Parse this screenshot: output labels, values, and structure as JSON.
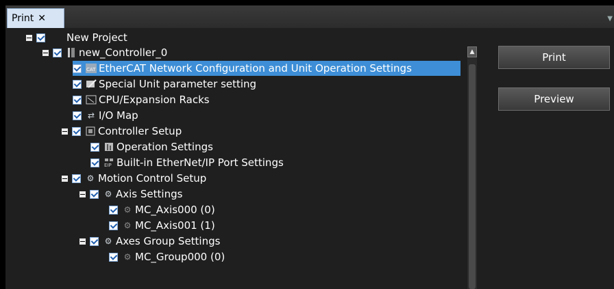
{
  "tab": {
    "title": "Print",
    "close_glyph": "✕"
  },
  "buttons": {
    "print": "Print",
    "preview": "Preview"
  },
  "tree": [
    {
      "label": "New Project",
      "icon": "none"
    },
    {
      "label": "new_Controller_0",
      "icon": "controller-icon"
    },
    {
      "label": "EtherCAT Network Configuration and Unit Operation Settings",
      "icon": "ethercat-icon",
      "selected": true
    },
    {
      "label": "Special Unit parameter setting",
      "icon": "parameter-icon"
    },
    {
      "label": "CPU/Expansion Racks",
      "icon": "rack-icon"
    },
    {
      "label": "I/O Map",
      "icon": "io-map-icon"
    },
    {
      "label": "Controller Setup",
      "icon": "controller-setup-icon"
    },
    {
      "label": "Operation Settings",
      "icon": "operation-settings-icon"
    },
    {
      "label": "Built-in EtherNet/IP Port Settings",
      "icon": "ethernet-ip-icon"
    },
    {
      "label": "Motion Control Setup",
      "icon": "motion-gear-icon"
    },
    {
      "label": "Axis Settings",
      "icon": "axis-gear-icon"
    },
    {
      "label": "MC_Axis000 (0)",
      "icon": "axis-item-icon"
    },
    {
      "label": "MC_Axis001 (1)",
      "icon": "axis-item-icon"
    },
    {
      "label": "Axes Group Settings",
      "icon": "axes-group-icon"
    },
    {
      "label": "MC_Group000 (0)",
      "icon": "group-item-icon"
    }
  ],
  "colors": {
    "selection": "#3d8ed6",
    "background": "#1f1f1f",
    "tab": "#d6e4f4"
  }
}
